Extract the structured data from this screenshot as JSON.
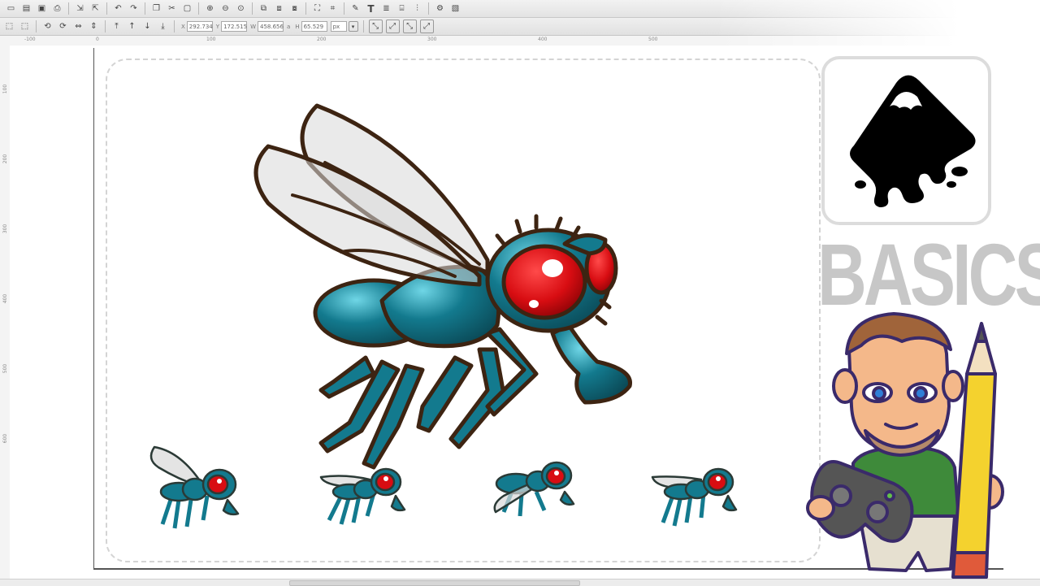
{
  "toolbar": {
    "icons": [
      "new-doc",
      "open",
      "save",
      "print",
      "import",
      "export",
      "undo",
      "redo",
      "copy",
      "cut",
      "paste",
      "zoom-in",
      "zoom-out",
      "zoom-fit",
      "duplicate",
      "clone",
      "unlink",
      "group",
      "ungroup",
      "fill-stroke",
      "text",
      "layers",
      "align",
      "xml-editor",
      "preferences"
    ]
  },
  "controls": {
    "x_label": "X",
    "x_value": "292.734",
    "y_label": "Y",
    "y_value": "172.515",
    "w_label": "W",
    "w_value": "458.656",
    "lock_label": "a",
    "h_label": "H",
    "h_value": "65.529",
    "unit": "px"
  },
  "ruler": {
    "h_labels": [
      "-100",
      "0",
      "100",
      "200",
      "300",
      "400",
      "500"
    ],
    "v_labels": [
      "100",
      "200",
      "300",
      "400",
      "500",
      "600"
    ]
  },
  "thumbnail": {
    "title": "BASICS",
    "logo": "inkscape-logo",
    "character": "cartoon-man-with-pencil-and-gamepad"
  },
  "colors": {
    "fly_body": "#137a8e",
    "fly_eye": "#d80d12",
    "outline": "#4a2a14",
    "wing": "#d9d9d9",
    "basics_text": "#c7c7c7",
    "pencil": "#f4d22e"
  }
}
